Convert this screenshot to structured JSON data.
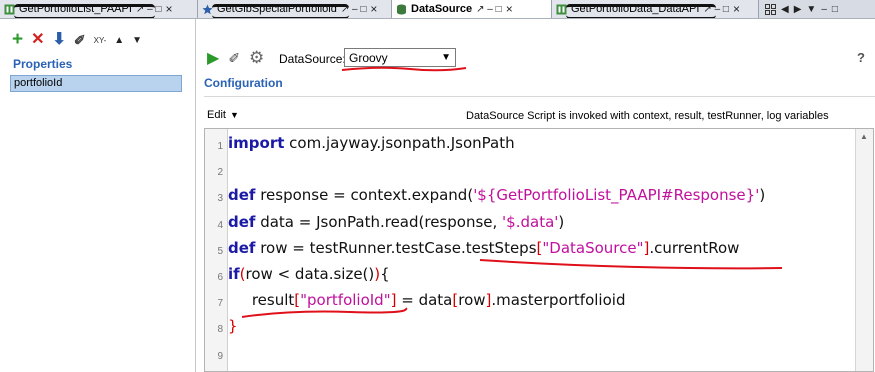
{
  "tabs": [
    {
      "label": "GetPortfolioList_PAAPI",
      "controls": "↗ – □"
    },
    {
      "label": "GetGlbSpecialPortfoliold",
      "controls": "↗ – □"
    },
    {
      "label": "DataSource",
      "controls": "↗ – □"
    },
    {
      "label": "GetPortfolioData_DataAPI",
      "controls": "↗ – □"
    }
  ],
  "tab_nav": [
    "◀",
    "▶",
    "▼",
    "–",
    "□"
  ],
  "properties": {
    "toolbar": {
      "add": "+",
      "remove": "✕",
      "download": "⬇",
      "eraser": "✐",
      "xy": "XY-",
      "up": "▲",
      "down": "▼"
    },
    "heading": "Properties",
    "items": [
      "portfolioId"
    ]
  },
  "datasource": {
    "toolbar": {
      "run": "▶",
      "clear": "✐",
      "settings": "⚙"
    },
    "label": "DataSource:",
    "selected": "Groovy",
    "help": "?",
    "config_heading": "Configuration",
    "edit_label": "Edit",
    "info": "DataSource Script is invoked with context, result, testRunner, log variables"
  },
  "code": [
    {
      "n": "1",
      "parts": [
        [
          "kw",
          "import"
        ],
        [
          "plain",
          " com.jayway.jsonpath.JsonPath"
        ]
      ]
    },
    {
      "n": "2",
      "parts": []
    },
    {
      "n": "3",
      "parts": [
        [
          "kw",
          "def"
        ],
        [
          "plain",
          " response = context.expand("
        ],
        [
          "str",
          "'${GetPortfolioList_PAAPI#Response}'"
        ],
        [
          "plain",
          ")"
        ]
      ]
    },
    {
      "n": "4",
      "parts": [
        [
          "kw",
          "def"
        ],
        [
          "plain",
          " data = JsonPath.read(response, "
        ],
        [
          "str",
          "'$.data'"
        ],
        [
          "plain",
          ")"
        ]
      ]
    },
    {
      "n": "5",
      "parts": [
        [
          "kw",
          "def"
        ],
        [
          "plain",
          " row = testRunner.testCase.testSteps"
        ],
        [
          "br",
          "["
        ],
        [
          "str",
          "\"DataSource\""
        ],
        [
          "br",
          "]"
        ],
        [
          "plain",
          ".currentRow"
        ]
      ]
    },
    {
      "n": "6",
      "parts": [
        [
          "kw",
          "if"
        ],
        [
          "br",
          "("
        ],
        [
          "plain",
          "row < data.size()"
        ],
        [
          "br",
          ")"
        ],
        [
          "plain",
          "{"
        ]
      ]
    },
    {
      "n": "7",
      "parts": [
        [
          "plain",
          "     result"
        ],
        [
          "br",
          "["
        ],
        [
          "str",
          "\"portfolioId\""
        ],
        [
          "br",
          "]"
        ],
        [
          "plain",
          " = data"
        ],
        [
          "br",
          "["
        ],
        [
          "plain",
          "row"
        ],
        [
          "br",
          "]"
        ],
        [
          "plain",
          ".masterportfolioid"
        ]
      ]
    },
    {
      "n": "8",
      "parts": [
        [
          "br",
          "}"
        ]
      ]
    },
    {
      "n": "9",
      "parts": []
    }
  ],
  "colors": {
    "keyword": "#1a1aa6",
    "string": "#c0109c",
    "bracket": "#d40000",
    "heading": "#2a62b5",
    "selection": "#b9d3ef",
    "annotation": "#e0101a"
  }
}
